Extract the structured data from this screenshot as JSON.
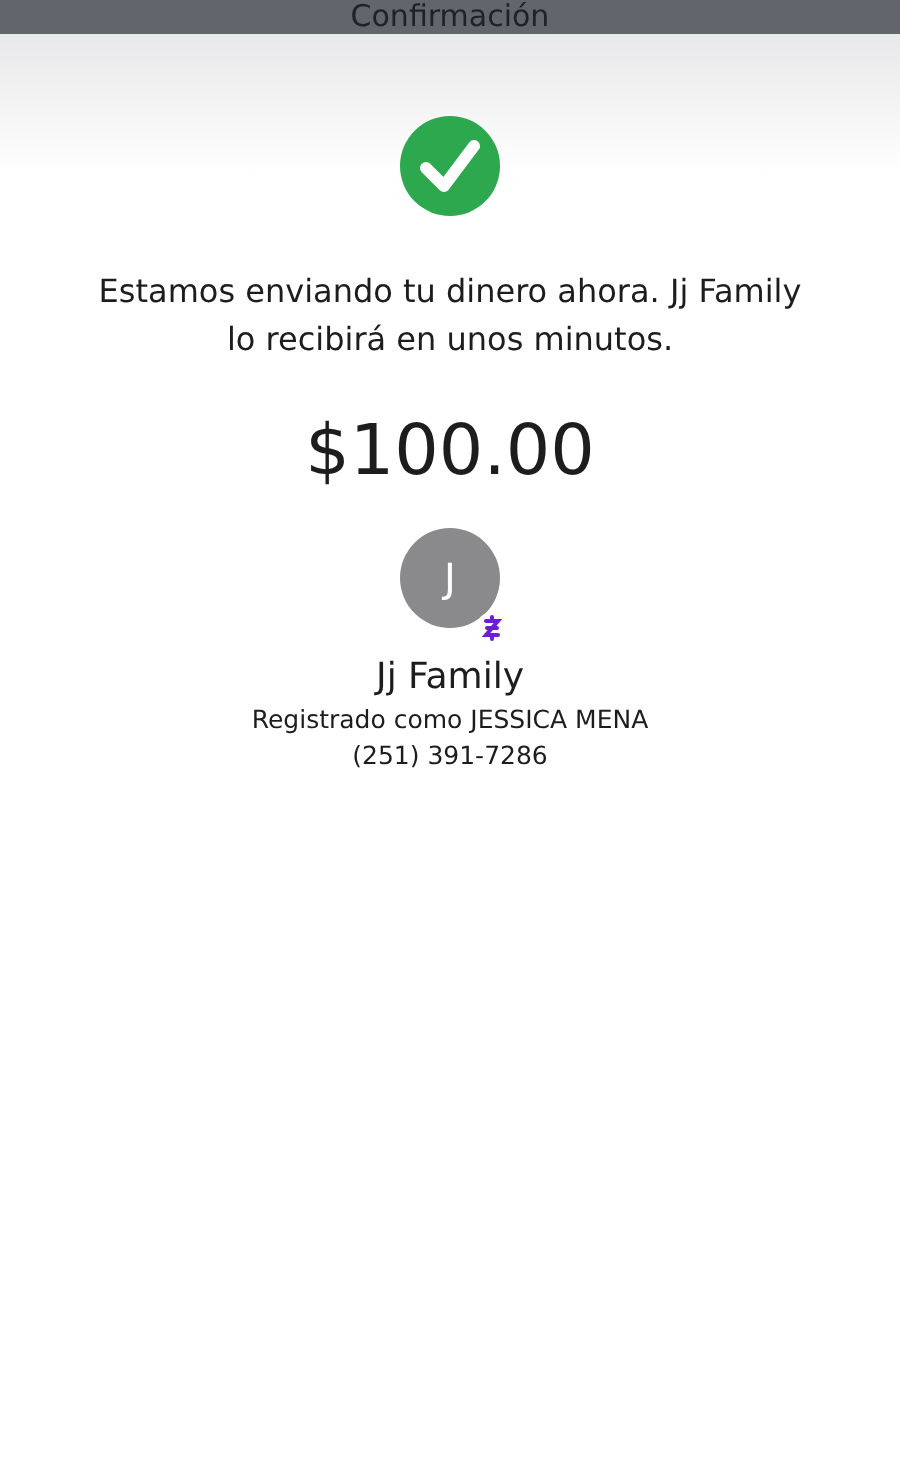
{
  "header": {
    "title": "Confirmación"
  },
  "message": "Estamos enviando tu dinero ahora. Jj Family lo recibirá en unos minutos.",
  "amount": "$100.00",
  "recipient": {
    "initial": "J",
    "name": "Jj Family",
    "registered_as": "Registrado como JESSICA MENA",
    "phone": "(251) 391-7286"
  }
}
